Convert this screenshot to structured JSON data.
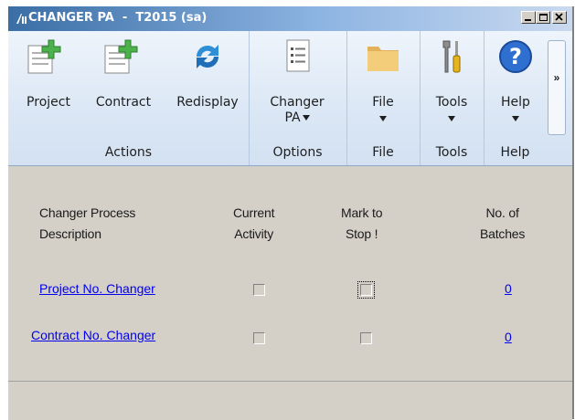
{
  "window": {
    "title": "CHANGER PA  -  T2015 (sa)"
  },
  "ribbon": {
    "actions": {
      "label": "Actions",
      "buttons": [
        {
          "label": "Project",
          "icon": "new-document-icon"
        },
        {
          "label": "Contract",
          "icon": "new-document-icon"
        },
        {
          "label": "Redisplay",
          "icon": "refresh-icon"
        }
      ]
    },
    "options": {
      "label": "Options",
      "button": {
        "label_line1": "Changer",
        "label_line2": "PA",
        "icon": "document-list-icon"
      }
    },
    "file": {
      "label": "File",
      "button": {
        "label": "File",
        "icon": "folder-icon"
      }
    },
    "tools": {
      "label": "Tools",
      "button": {
        "label": "Tools",
        "icon": "tools-icon"
      }
    },
    "help": {
      "label": "Help",
      "button": {
        "label": "Help",
        "icon": "help-icon"
      }
    },
    "overflow_label": "»"
  },
  "table": {
    "headers": {
      "description_line1": "Changer Process",
      "description_line2": "Description",
      "current_line1": "Current",
      "current_line2": "Activity",
      "mark_line1": "Mark to",
      "mark_line2": "Stop !",
      "batches_line1": "No. of",
      "batches_line2": "Batches"
    },
    "rows": [
      {
        "description": "Project No. Changer",
        "current_activity": false,
        "mark_to_stop": false,
        "batches": "0"
      },
      {
        "description": "Contract No. Changer",
        "current_activity": false,
        "mark_to_stop": false,
        "batches": "0"
      }
    ]
  },
  "colors": {
    "link": "#0000ee",
    "ribbon": "#dbe7f5",
    "window_bg": "#d4d0c8",
    "titlebar": "#3a6ea5"
  }
}
